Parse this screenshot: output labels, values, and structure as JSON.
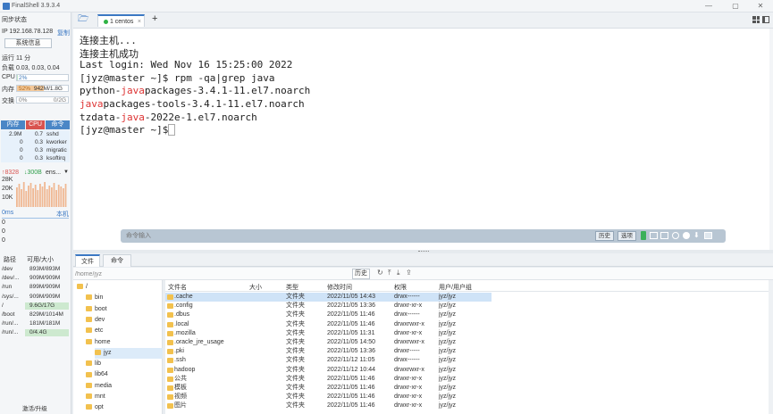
{
  "window": {
    "title": "FinalShell 3.9.3.4",
    "controls": [
      "—",
      "▢",
      "✕"
    ]
  },
  "sidebar": {
    "sync_status": "同步状态",
    "ip_label": "IP 192.168.78.128",
    "copy_label": "复制",
    "sysinfo_button": "系统信息",
    "uptime": "运行 11 分",
    "load": "负载 0.03, 0.03, 0.04",
    "cpu_label": "CPU",
    "cpu_value": "2%",
    "cpu_percent": 2,
    "mem_label": "内存",
    "mem_percent_text": "52%",
    "mem_value": "942M/1.8G",
    "mem_percent": 52,
    "swap_label": "交换",
    "swap_percent_text": "0%",
    "swap_value": "0/2G",
    "proc_headers": [
      "内存",
      "CPU",
      "命令"
    ],
    "processes": [
      {
        "mem": "2.9M",
        "cpu": "0.7",
        "cmd": "sshd"
      },
      {
        "mem": "0",
        "cpu": "0.3",
        "cmd": "kworker"
      },
      {
        "mem": "0",
        "cpu": "0.3",
        "cmd": "migratic"
      },
      {
        "mem": "0",
        "cpu": "0.3",
        "cmd": "ksoftirq"
      }
    ],
    "net_up": "↑8328",
    "net_down": "↓300B",
    "net_iface": "ens...",
    "net_scale": [
      "28K",
      "20K",
      "10K"
    ],
    "latency": "0ms",
    "host_label": "本机",
    "ping_values": [
      "0",
      "0",
      "0"
    ],
    "disk_headers": [
      "路径",
      "可用/大小"
    ],
    "disks": [
      {
        "path": "/dev",
        "size": "893M/893M"
      },
      {
        "path": "/dev/...",
        "size": "909M/909M"
      },
      {
        "path": "/run",
        "size": "899M/909M"
      },
      {
        "path": "/sys/...",
        "size": "909M/909M"
      },
      {
        "path": "/",
        "size": "9.6G/17G"
      },
      {
        "path": "/boot",
        "size": "829M/1014M"
      },
      {
        "path": "/run/...",
        "size": "181M/181M"
      },
      {
        "path": "/run/...",
        "size": "0/4.4G"
      }
    ],
    "activate_label": "激活/升级"
  },
  "tabs": {
    "active_label": "1 centos",
    "close_glyph": "×",
    "add_glyph": "+"
  },
  "terminal": {
    "lines": [
      {
        "parts": [
          {
            "t": "连接主机...",
            "c": ""
          }
        ]
      },
      {
        "parts": [
          {
            "t": "连接主机成功",
            "c": ""
          }
        ]
      },
      {
        "parts": [
          {
            "t": "Last login: Wed Nov 16 15:25:00 2022",
            "c": ""
          }
        ]
      },
      {
        "parts": [
          {
            "t": "[jyz@master ~]$ rpm -qa|grep java",
            "c": ""
          }
        ]
      },
      {
        "parts": [
          {
            "t": "python-",
            "c": ""
          },
          {
            "t": "java",
            "c": "red"
          },
          {
            "t": "packages-3.4.1-11.el7.noarch",
            "c": ""
          }
        ]
      },
      {
        "parts": [
          {
            "t": "java",
            "c": "red"
          },
          {
            "t": "packages-tools-3.4.1-11.el7.noarch",
            "c": ""
          }
        ]
      },
      {
        "parts": [
          {
            "t": "tzdata-",
            "c": ""
          },
          {
            "t": "java",
            "c": "red"
          },
          {
            "t": "-2022e-1.el7.noarch",
            "c": ""
          }
        ]
      },
      {
        "parts": [
          {
            "t": "[jyz@master ~]$ ",
            "c": ""
          }
        ]
      }
    ],
    "command_placeholder": "命令输入",
    "history_button": "历史",
    "options_button": "选项"
  },
  "file_manager": {
    "tabs": [
      "文件",
      "命令"
    ],
    "path": "/home/jyz",
    "history_button": "历史",
    "tree": [
      {
        "label": "/",
        "level": 0
      },
      {
        "label": "bin",
        "level": 1
      },
      {
        "label": "boot",
        "level": 1
      },
      {
        "label": "dev",
        "level": 1
      },
      {
        "label": "etc",
        "level": 1
      },
      {
        "label": "home",
        "level": 1
      },
      {
        "label": "jyz",
        "level": 2
      },
      {
        "label": "lib",
        "level": 1
      },
      {
        "label": "lib64",
        "level": 1
      },
      {
        "label": "media",
        "level": 1
      },
      {
        "label": "mnt",
        "level": 1
      },
      {
        "label": "opt",
        "level": 1
      }
    ],
    "columns": [
      "文件名",
      "大小",
      "类型",
      "修改时间",
      "权限",
      "用户/用户组"
    ],
    "files": [
      {
        "name": ".cache",
        "size": "",
        "type": "文件夹",
        "mtime": "2022/11/05 14:43",
        "perm": "drwx------",
        "owner": "jyz/jyz"
      },
      {
        "name": ".config",
        "size": "",
        "type": "文件夹",
        "mtime": "2022/11/05 13:36",
        "perm": "drwxr-xr-x",
        "owner": "jyz/jyz"
      },
      {
        "name": ".dbus",
        "size": "",
        "type": "文件夹",
        "mtime": "2022/11/05 11:46",
        "perm": "drwx------",
        "owner": "jyz/jyz"
      },
      {
        "name": ".local",
        "size": "",
        "type": "文件夹",
        "mtime": "2022/11/05 11:46",
        "perm": "drwxrwxr-x",
        "owner": "jyz/jyz"
      },
      {
        "name": ".mozilla",
        "size": "",
        "type": "文件夹",
        "mtime": "2022/11/05 11:31",
        "perm": "drwxr-xr-x",
        "owner": "jyz/jyz"
      },
      {
        "name": ".oracle_jre_usage",
        "size": "",
        "type": "文件夹",
        "mtime": "2022/11/05 14:50",
        "perm": "drwxrwxr-x",
        "owner": "jyz/jyz"
      },
      {
        "name": ".pki",
        "size": "",
        "type": "文件夹",
        "mtime": "2022/11/05 13:36",
        "perm": "drwxr-----",
        "owner": "jyz/jyz"
      },
      {
        "name": ".ssh",
        "size": "",
        "type": "文件夹",
        "mtime": "2022/11/12 11:05",
        "perm": "drwx------",
        "owner": "jyz/jyz"
      },
      {
        "name": "hadoop",
        "size": "",
        "type": "文件夹",
        "mtime": "2022/11/12 10:44",
        "perm": "drwxrwxr-x",
        "owner": "jyz/jyz"
      },
      {
        "name": "公共",
        "size": "",
        "type": "文件夹",
        "mtime": "2022/11/05 11:46",
        "perm": "drwxr-xr-x",
        "owner": "jyz/jyz"
      },
      {
        "name": "模板",
        "size": "",
        "type": "文件夹",
        "mtime": "2022/11/05 11:46",
        "perm": "drwxr-xr-x",
        "owner": "jyz/jyz"
      },
      {
        "name": "视频",
        "size": "",
        "type": "文件夹",
        "mtime": "2022/11/05 11:46",
        "perm": "drwxr-xr-x",
        "owner": "jyz/jyz"
      },
      {
        "name": "图片",
        "size": "",
        "type": "文件夹",
        "mtime": "2022/11/05 11:46",
        "perm": "drwxr-xr-x",
        "owner": "jyz/jyz"
      }
    ]
  },
  "colors": {
    "accent": "#3b78c3",
    "tab_green": "#2fb344",
    "highlight_red": "#dd3333",
    "proc_header_blue": "#4a86c6",
    "proc_header_red": "#d9534f"
  }
}
